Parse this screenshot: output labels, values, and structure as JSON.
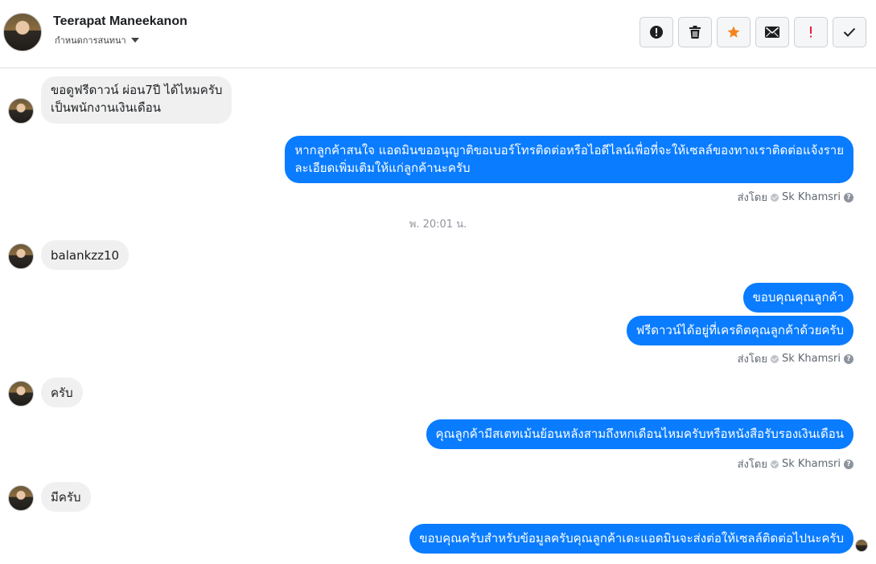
{
  "header": {
    "name": "Teerapat Maneekanon",
    "subtitle": "กำหนดการสนทนา"
  },
  "toolbar": [
    {
      "icon": "alert-circle-icon",
      "name": "mark-spam-button"
    },
    {
      "icon": "trash-icon",
      "name": "delete-button"
    },
    {
      "icon": "star-icon",
      "name": "star-button",
      "color": "#f5841f"
    },
    {
      "icon": "envelope-icon",
      "name": "mark-unread-button"
    },
    {
      "icon": "exclamation-icon",
      "name": "mark-important-button",
      "color": "#e41e3f"
    },
    {
      "icon": "check-icon",
      "name": "mark-done-button"
    }
  ],
  "messages": {
    "m1_line1": "ขอดูฟรีดาวน์ ผ่อน7ปี ได้ไหมครับ",
    "m1_line2": "เป็นพนักงานเงินเดือน",
    "m2_line1": "หากลูกค้าสนใจ แอดมินขออนุญาติขอเบอร์โทรติดต่อหรือไอดีไลน์เพื่อที่จะให้เซลล์ของทางเราติดต่อแจ้งราย",
    "m2_line2": "ละเอียดเพิ่มเติมให้แก่ลูกค้านะครับ",
    "timestamp": "พ. 20:01 น.",
    "m3": "balankzz10",
    "m4": "ขอบคุณคุณลูกค้า",
    "m5": "ฟรีดาวน์ได้อยู่ที่เครดิตคุณลูกค้าด้วยครับ",
    "m6": "ครับ",
    "m7": "คุณลูกค้ามีสเตทเม้นย้อนหลังสามถึงหกเดือนไหมครับหรือหนังสือรับรองเงินเดือน",
    "m8": "มีครับ",
    "m9": "ขอบคุณครับสำหรับข้อมูลครับคุณลูกค้าเดะแอดมินจะส่งต่อให้เซลล์ติดต่อไปนะครับ"
  },
  "sent_by": {
    "prefix": "ส่งโดย",
    "agent": "Sk Khamsri",
    "help": "?"
  },
  "colors": {
    "outgoing_bubble": "#0a7cff",
    "incoming_bubble": "#f0f0f0"
  }
}
